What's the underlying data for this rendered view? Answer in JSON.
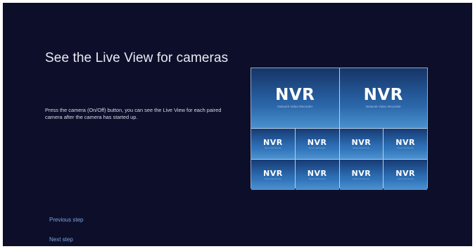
{
  "screen": {
    "title": "See the Live View for cameras",
    "description": "Press the camera (On/Off) button, you can see the Live View for each paired camera after the camera has started up.",
    "nav": {
      "previous_label": "Previous step",
      "next_label": "Next step"
    }
  },
  "live_view": {
    "logo_text": "NVR",
    "logo_subtitle": "Network Video Recorder",
    "tile_count_large": 2,
    "tile_count_small": 8
  },
  "colors": {
    "background": "#0d0f2a",
    "title_text": "#e9ebf5",
    "link_text": "#7da5dd",
    "tile_top": "#173a73",
    "tile_bottom": "#3d86c9"
  }
}
